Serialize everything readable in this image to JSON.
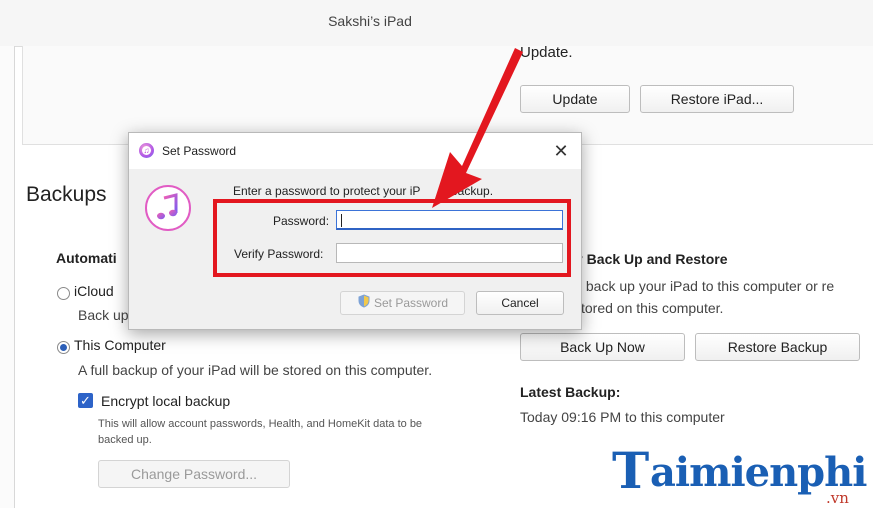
{
  "window": {
    "title": "Sakshi’s iPad"
  },
  "software": {
    "update_text": "Update.",
    "update_button": "Update",
    "restore_button": "Restore iPad..."
  },
  "backups": {
    "title": "Backups",
    "auto_heading": "Automati",
    "icloud_label": "iCloud",
    "icloud_desc": "Back up",
    "this_computer_label": "This Computer",
    "this_computer_desc": "A full backup of your iPad will be stored on this computer.",
    "encrypt_label": "Encrypt local backup",
    "encrypt_desc_line1": "This will allow account passwords, Health, and HomeKit data to be",
    "encrypt_desc_line2": "backed up.",
    "change_password_button": "Change Password...",
    "manual_heading": "y Back Up and Restore",
    "manual_desc_line1": "y back up your iPad to this computer or re",
    "manual_desc_line2": "tored on this computer.",
    "back_up_now_button": "Back Up Now",
    "restore_backup_button": "Restore Backup",
    "latest_backup_heading": "Latest Backup:",
    "latest_backup_value": "Today 09:16 PM to this computer"
  },
  "dialog": {
    "title": "Set Password",
    "close_glyph": "✕",
    "prompt": "Enter a password to protect your iP",
    "prompt_tail": "backup.",
    "password_label": "Password:",
    "password_value": "",
    "verify_label": "Verify Password:",
    "verify_value": "",
    "set_password_button": "Set Password",
    "cancel_button": "Cancel"
  },
  "watermark": {
    "logo_t": "T",
    "logo_rest": "aimienphi",
    "logo_suffix": ".vn"
  },
  "colors": {
    "highlight": "#e3171f",
    "accent": "#2d63c8",
    "logo": "#1a5fb4"
  },
  "icons": [
    "itunes-icon",
    "close-icon",
    "shield-icon",
    "pointer-arrow-icon"
  ]
}
